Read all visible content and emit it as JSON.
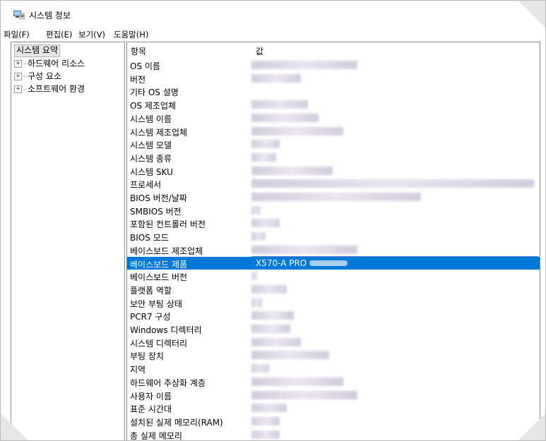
{
  "window": {
    "title": "시스템 정보"
  },
  "menu": [
    "파일(F)",
    "편집(E)",
    "보기(V)",
    "도움말(H)"
  ],
  "tree": {
    "root": "시스템 요약",
    "children": [
      "하드웨어 리소스",
      "구성 요소",
      "소프트웨어 환경"
    ]
  },
  "list": {
    "headers": {
      "item": "항목",
      "value": "값"
    },
    "rows": [
      {
        "item": "OS 이름",
        "value": ""
      },
      {
        "item": "버전",
        "value": ""
      },
      {
        "item": "기타 OS 설명",
        "value": ""
      },
      {
        "item": "OS 제조업체",
        "value": ""
      },
      {
        "item": "시스템 이름",
        "value": ""
      },
      {
        "item": "시스템 제조업체",
        "value": ""
      },
      {
        "item": "시스템 모델",
        "value": ""
      },
      {
        "item": "시스템 종류",
        "value": ""
      },
      {
        "item": "시스템 SKU",
        "value": ""
      },
      {
        "item": "프로세서",
        "value": ""
      },
      {
        "item": "BIOS 버전/날짜",
        "value": ""
      },
      {
        "item": "SMBIOS 버전",
        "value": ""
      },
      {
        "item": "포함된 컨트롤러 버전",
        "value": ""
      },
      {
        "item": "BIOS 모드",
        "value": ""
      },
      {
        "item": "베이스보드 제조업체",
        "value": ""
      },
      {
        "item": "베이스보드 제품",
        "value": "X570-A PRO"
      },
      {
        "item": "베이스보드 버전",
        "value": ""
      },
      {
        "item": "플랫폼 역할",
        "value": ""
      },
      {
        "item": "보안 부팅 상태",
        "value": ""
      },
      {
        "item": "PCR7 구성",
        "value": ""
      },
      {
        "item": "Windows 디렉터리",
        "value": ""
      },
      {
        "item": "시스템 디렉터리",
        "value": ""
      },
      {
        "item": "부팅 장치",
        "value": ""
      },
      {
        "item": "지역",
        "value": ""
      },
      {
        "item": "하드웨어 추상화 계층",
        "value": ""
      },
      {
        "item": "사용자 이름",
        "value": ""
      },
      {
        "item": "표준 시간대",
        "value": ""
      },
      {
        "item": "설치된 실제 메모리(RAM)",
        "value": ""
      },
      {
        "item": "총 실제 메모리",
        "value": ""
      }
    ]
  },
  "colors": {
    "selection": "#0078d7",
    "redacted": "#c9c3d8"
  }
}
